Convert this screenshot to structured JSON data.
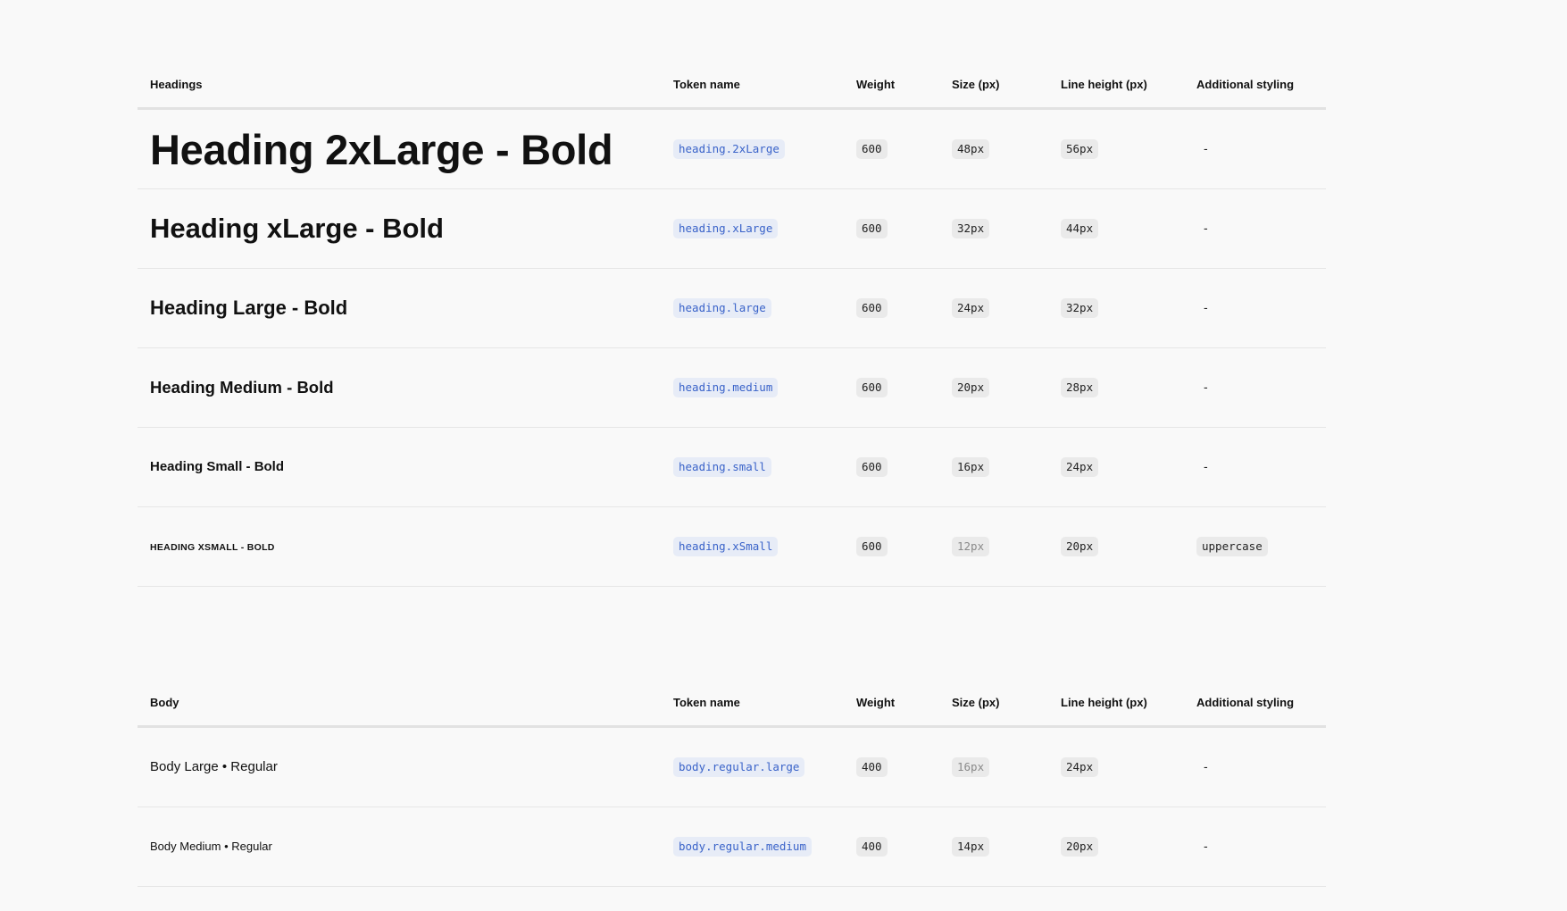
{
  "headings_table": {
    "columns": [
      "Headings",
      "Token name",
      "Weight",
      "Size (px)",
      "Line height (px)",
      "Additional styling"
    ],
    "rows": [
      {
        "sample": "Heading 2xLarge - Bold",
        "token": "heading.2xLarge",
        "weight": "600",
        "size": "48px",
        "line_height": "56px",
        "styling": "-"
      },
      {
        "sample": "Heading xLarge - Bold",
        "token": "heading.xLarge",
        "weight": "600",
        "size": "32px",
        "line_height": "44px",
        "styling": "-"
      },
      {
        "sample": "Heading Large - Bold",
        "token": "heading.large",
        "weight": "600",
        "size": "24px",
        "line_height": "32px",
        "styling": "-"
      },
      {
        "sample": "Heading Medium - Bold",
        "token": "heading.medium",
        "weight": "600",
        "size": "20px",
        "line_height": "28px",
        "styling": "-"
      },
      {
        "sample": "Heading Small - Bold",
        "token": "heading.small",
        "weight": "600",
        "size": "16px",
        "line_height": "24px",
        "styling": "-"
      },
      {
        "sample": "Heading xSmall - Bold",
        "token": "heading.xSmall",
        "weight": "600",
        "size": "12px",
        "line_height": "20px",
        "styling": "uppercase"
      }
    ]
  },
  "body_table": {
    "columns": [
      "Body",
      "Token name",
      "Weight",
      "Size (px)",
      "Line height (px)",
      "Additional styling"
    ],
    "rows": [
      {
        "sample": "Body Large • Regular",
        "token": "body.regular.large",
        "weight": "400",
        "size": "16px",
        "line_height": "24px",
        "styling": "-"
      },
      {
        "sample": "Body Medium • Regular",
        "token": "body.regular.medium",
        "weight": "400",
        "size": "14px",
        "line_height": "20px",
        "styling": "-"
      }
    ]
  }
}
